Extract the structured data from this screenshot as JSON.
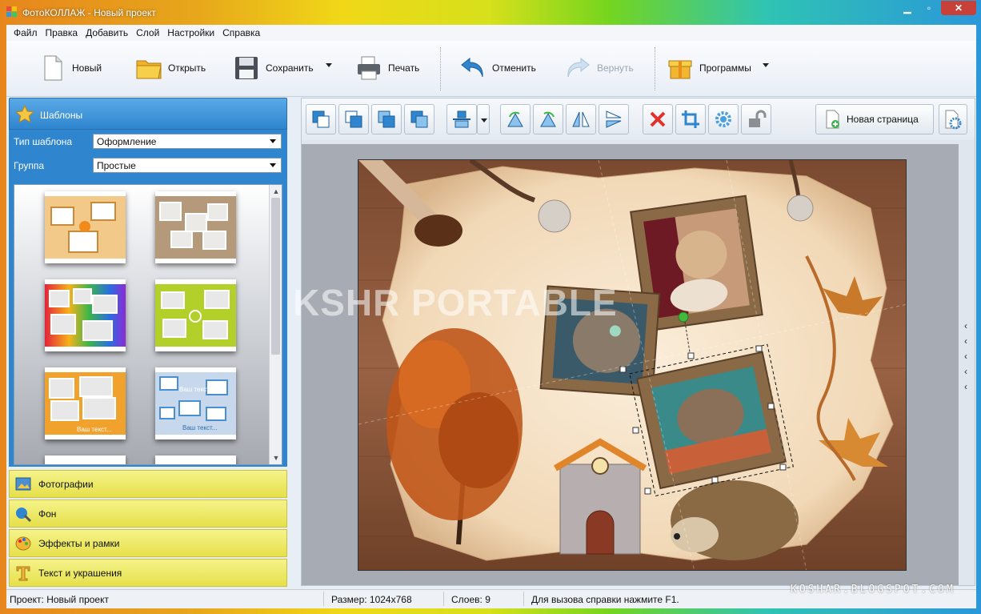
{
  "window": {
    "title": "ФотоКОЛЛАЖ - Новый проект"
  },
  "menu": [
    "Файл",
    "Правка",
    "Добавить",
    "Слой",
    "Настройки",
    "Справка"
  ],
  "toolbar": {
    "new": "Новый",
    "open": "Открыть",
    "save": "Сохранить",
    "print": "Печать",
    "undo": "Отменить",
    "redo": "Вернуть",
    "programs": "Программы"
  },
  "left_panel": {
    "header": "Шаблоны",
    "template_type_label": "Тип шаблона",
    "template_type_value": "Оформление",
    "group_label": "Группа",
    "group_value": "Простые",
    "thumb_text_1": "Ваш текст...",
    "thumb_text_2": "Ваш текст...",
    "thumb_text_3": "Ваш текст...",
    "sections": [
      "Фотографии",
      "Фон",
      "Эффекты и рамки",
      "Текст и украшения"
    ]
  },
  "canvas": {
    "new_page_button": "Новая страница",
    "watermark": "KSHR PORTABLE"
  },
  "status": {
    "project": "Проект: Новый проект",
    "size": "Размер: 1024x768",
    "layers": "Слоев: 9",
    "help": "Для вызова справки нажмите F1."
  },
  "credit": "KOSHAR.BLOGSPOT.COM",
  "colors": {
    "panel_blue": "#2f86cf",
    "accordion_yellow": "#e6e04a",
    "selection_handle": "#44b83a"
  }
}
